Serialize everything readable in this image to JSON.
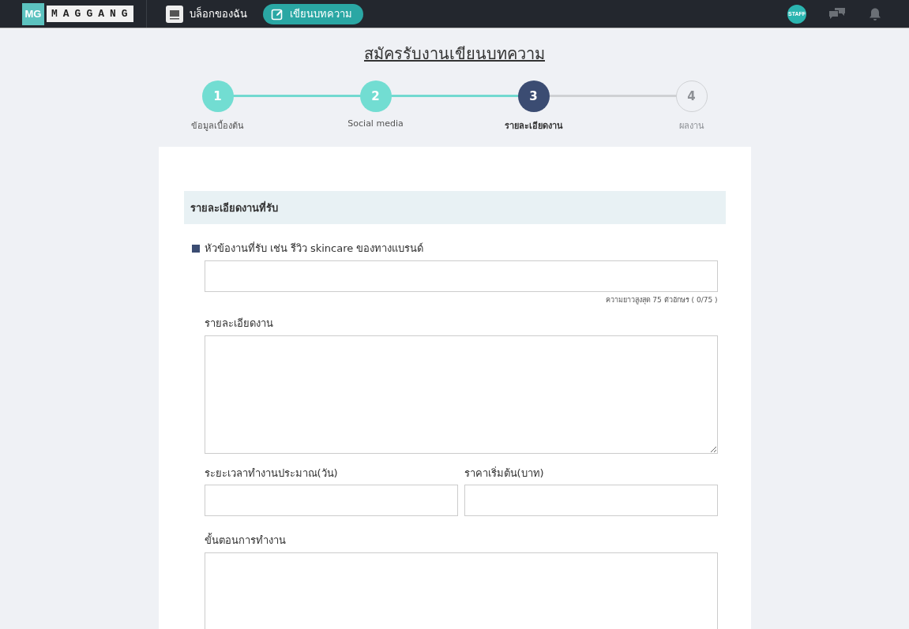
{
  "header": {
    "logo_mark": "MG",
    "logo_word": "MAGGANG",
    "nav": [
      {
        "label": "บล็อกของฉัน",
        "kind": "blog"
      },
      {
        "label": "เขียนบทความ",
        "kind": "write"
      }
    ],
    "avatar": "STAFF"
  },
  "page_title": "สมัครรับงานเขียนบทความ",
  "steps": [
    {
      "number": "1",
      "label": "ข้อมูลเบื้องต้น",
      "completed": true,
      "selected": false
    },
    {
      "number": "2",
      "label": "Social media",
      "completed": true,
      "selected": false
    },
    {
      "number": "3",
      "label": "รายละเอียดงาน",
      "completed": false,
      "selected": true
    },
    {
      "number": "4",
      "label": "ผลงาน",
      "completed": false,
      "selected": false
    }
  ],
  "section_title": "รายละเอียดงานที่รับ",
  "fields": [
    {
      "kind": "text",
      "label": "หัวข้องานที่รับ เช่น รีวิว skincare ของทางแบรนด์",
      "bullet": true,
      "hint": "ความยาวสูงสุด 75 ตัวอักษร ( 0/75 )"
    },
    {
      "kind": "textarea",
      "label": "รายละเอียดงาน",
      "bullet": false
    },
    {
      "kind": "pair",
      "items": [
        {
          "label": "ระยะเวลาทำงานประมาณ(วัน)"
        },
        {
          "label": "ราคาเริ่มต้น(บาท)"
        }
      ]
    },
    {
      "kind": "textarea",
      "label": "ขั้นตอนการทำงาน",
      "bullet": false
    }
  ]
}
